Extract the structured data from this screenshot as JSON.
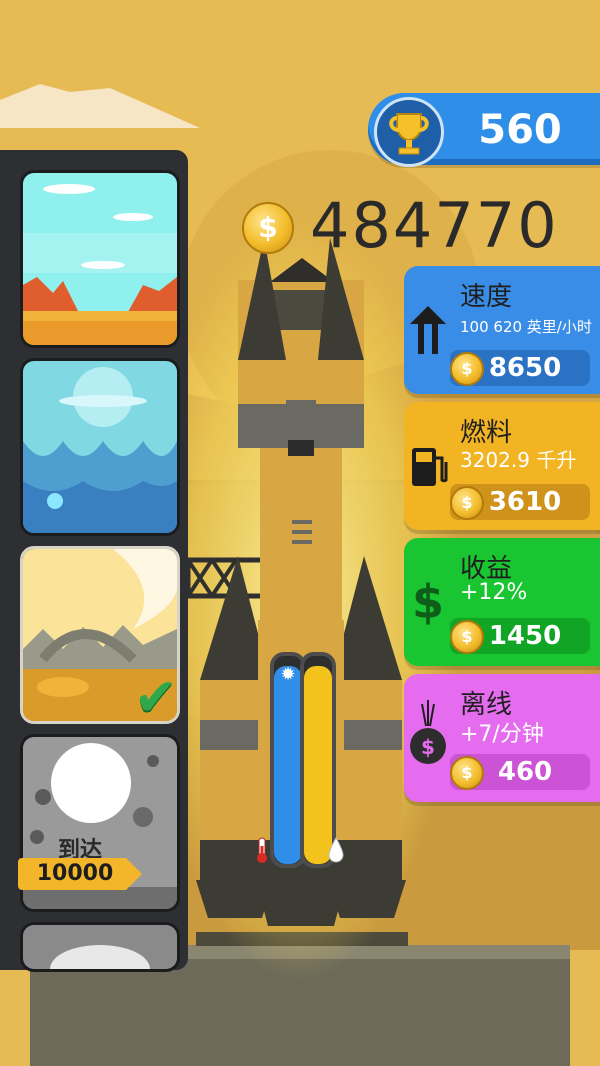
{
  "trophy": {
    "icon": "trophy-icon",
    "value": "560"
  },
  "coins": {
    "icon": "coin-icon",
    "symbol": "$",
    "value": "484770"
  },
  "levels": [
    {
      "name": "level-earth-sky",
      "state": "unlocked"
    },
    {
      "name": "level-ice-planet",
      "state": "unlocked"
    },
    {
      "name": "level-desert-planet",
      "state": "selected"
    },
    {
      "name": "level-moon",
      "state": "locked",
      "arrive_label": "到达",
      "arrive_value": "10000"
    },
    {
      "name": "level-next",
      "state": "locked"
    }
  ],
  "upgrades": {
    "speed": {
      "title": "速度",
      "subtitle": "100 620 英里/小时",
      "price": "8650",
      "color": "#3a8de6",
      "icon": "speed-arrows-icon"
    },
    "fuel": {
      "title": "燃料",
      "subtitle": "3202.9 千升",
      "price": "3610",
      "color": "#f2b423",
      "icon": "fuel-pump-icon"
    },
    "income": {
      "title": "收益",
      "subtitle": "+12%",
      "price": "1450",
      "color": "#19c531",
      "icon": "dollar-icon"
    },
    "offline": {
      "title": "离线",
      "subtitle": "+7/分钟",
      "price": "460",
      "color": "#e66cef",
      "icon": "money-bag-icon"
    }
  },
  "gauges": {
    "temperature": {
      "level": 0.95,
      "color": "#2f8ee8",
      "icon": "snowflake-icon",
      "bottom_icon": "thermometer-icon"
    },
    "fuel": {
      "level": 0.95,
      "color": "#f3c21c",
      "icon": "droplet-icon"
    }
  }
}
